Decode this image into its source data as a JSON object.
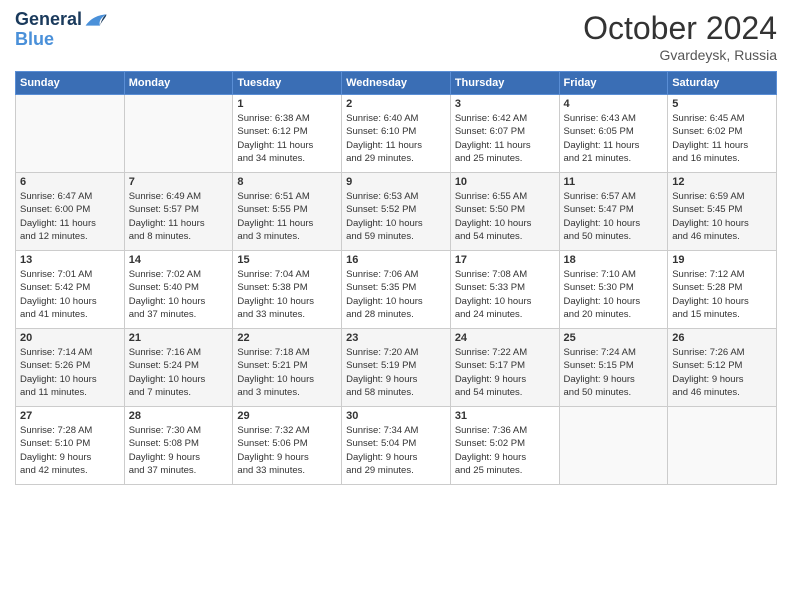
{
  "header": {
    "logo_line1": "General",
    "logo_line2": "Blue",
    "month": "October 2024",
    "location": "Gvardeysk, Russia"
  },
  "weekdays": [
    "Sunday",
    "Monday",
    "Tuesday",
    "Wednesday",
    "Thursday",
    "Friday",
    "Saturday"
  ],
  "weeks": [
    [
      {
        "day": "",
        "info": ""
      },
      {
        "day": "",
        "info": ""
      },
      {
        "day": "1",
        "info": "Sunrise: 6:38 AM\nSunset: 6:12 PM\nDaylight: 11 hours\nand 34 minutes."
      },
      {
        "day": "2",
        "info": "Sunrise: 6:40 AM\nSunset: 6:10 PM\nDaylight: 11 hours\nand 29 minutes."
      },
      {
        "day": "3",
        "info": "Sunrise: 6:42 AM\nSunset: 6:07 PM\nDaylight: 11 hours\nand 25 minutes."
      },
      {
        "day": "4",
        "info": "Sunrise: 6:43 AM\nSunset: 6:05 PM\nDaylight: 11 hours\nand 21 minutes."
      },
      {
        "day": "5",
        "info": "Sunrise: 6:45 AM\nSunset: 6:02 PM\nDaylight: 11 hours\nand 16 minutes."
      }
    ],
    [
      {
        "day": "6",
        "info": "Sunrise: 6:47 AM\nSunset: 6:00 PM\nDaylight: 11 hours\nand 12 minutes."
      },
      {
        "day": "7",
        "info": "Sunrise: 6:49 AM\nSunset: 5:57 PM\nDaylight: 11 hours\nand 8 minutes."
      },
      {
        "day": "8",
        "info": "Sunrise: 6:51 AM\nSunset: 5:55 PM\nDaylight: 11 hours\nand 3 minutes."
      },
      {
        "day": "9",
        "info": "Sunrise: 6:53 AM\nSunset: 5:52 PM\nDaylight: 10 hours\nand 59 minutes."
      },
      {
        "day": "10",
        "info": "Sunrise: 6:55 AM\nSunset: 5:50 PM\nDaylight: 10 hours\nand 54 minutes."
      },
      {
        "day": "11",
        "info": "Sunrise: 6:57 AM\nSunset: 5:47 PM\nDaylight: 10 hours\nand 50 minutes."
      },
      {
        "day": "12",
        "info": "Sunrise: 6:59 AM\nSunset: 5:45 PM\nDaylight: 10 hours\nand 46 minutes."
      }
    ],
    [
      {
        "day": "13",
        "info": "Sunrise: 7:01 AM\nSunset: 5:42 PM\nDaylight: 10 hours\nand 41 minutes."
      },
      {
        "day": "14",
        "info": "Sunrise: 7:02 AM\nSunset: 5:40 PM\nDaylight: 10 hours\nand 37 minutes."
      },
      {
        "day": "15",
        "info": "Sunrise: 7:04 AM\nSunset: 5:38 PM\nDaylight: 10 hours\nand 33 minutes."
      },
      {
        "day": "16",
        "info": "Sunrise: 7:06 AM\nSunset: 5:35 PM\nDaylight: 10 hours\nand 28 minutes."
      },
      {
        "day": "17",
        "info": "Sunrise: 7:08 AM\nSunset: 5:33 PM\nDaylight: 10 hours\nand 24 minutes."
      },
      {
        "day": "18",
        "info": "Sunrise: 7:10 AM\nSunset: 5:30 PM\nDaylight: 10 hours\nand 20 minutes."
      },
      {
        "day": "19",
        "info": "Sunrise: 7:12 AM\nSunset: 5:28 PM\nDaylight: 10 hours\nand 15 minutes."
      }
    ],
    [
      {
        "day": "20",
        "info": "Sunrise: 7:14 AM\nSunset: 5:26 PM\nDaylight: 10 hours\nand 11 minutes."
      },
      {
        "day": "21",
        "info": "Sunrise: 7:16 AM\nSunset: 5:24 PM\nDaylight: 10 hours\nand 7 minutes."
      },
      {
        "day": "22",
        "info": "Sunrise: 7:18 AM\nSunset: 5:21 PM\nDaylight: 10 hours\nand 3 minutes."
      },
      {
        "day": "23",
        "info": "Sunrise: 7:20 AM\nSunset: 5:19 PM\nDaylight: 9 hours\nand 58 minutes."
      },
      {
        "day": "24",
        "info": "Sunrise: 7:22 AM\nSunset: 5:17 PM\nDaylight: 9 hours\nand 54 minutes."
      },
      {
        "day": "25",
        "info": "Sunrise: 7:24 AM\nSunset: 5:15 PM\nDaylight: 9 hours\nand 50 minutes."
      },
      {
        "day": "26",
        "info": "Sunrise: 7:26 AM\nSunset: 5:12 PM\nDaylight: 9 hours\nand 46 minutes."
      }
    ],
    [
      {
        "day": "27",
        "info": "Sunrise: 7:28 AM\nSunset: 5:10 PM\nDaylight: 9 hours\nand 42 minutes."
      },
      {
        "day": "28",
        "info": "Sunrise: 7:30 AM\nSunset: 5:08 PM\nDaylight: 9 hours\nand 37 minutes."
      },
      {
        "day": "29",
        "info": "Sunrise: 7:32 AM\nSunset: 5:06 PM\nDaylight: 9 hours\nand 33 minutes."
      },
      {
        "day": "30",
        "info": "Sunrise: 7:34 AM\nSunset: 5:04 PM\nDaylight: 9 hours\nand 29 minutes."
      },
      {
        "day": "31",
        "info": "Sunrise: 7:36 AM\nSunset: 5:02 PM\nDaylight: 9 hours\nand 25 minutes."
      },
      {
        "day": "",
        "info": ""
      },
      {
        "day": "",
        "info": ""
      }
    ]
  ]
}
